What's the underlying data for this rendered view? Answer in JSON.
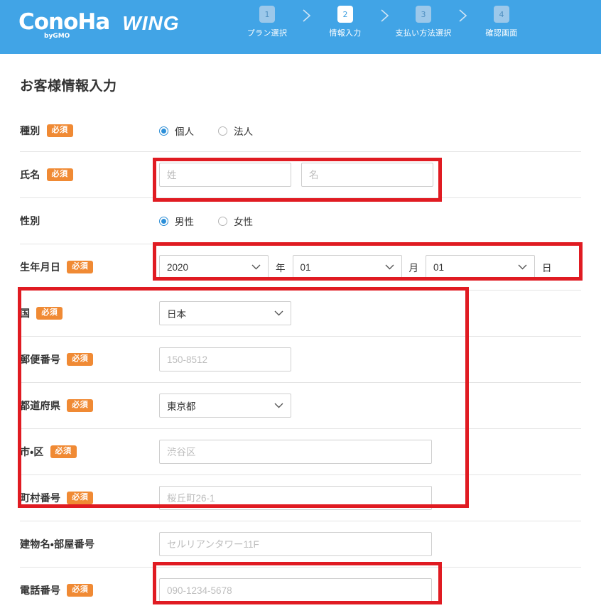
{
  "header": {
    "logo": {
      "brand": "ConoHa",
      "byline": "byGMO",
      "product": "WING"
    },
    "steps": [
      {
        "number": "1",
        "label": "プラン選択",
        "state": "done"
      },
      {
        "number": "2",
        "label": "情報入力",
        "state": "current"
      },
      {
        "number": "3",
        "label": "支払い方法選択",
        "state": "todo"
      },
      {
        "number": "4",
        "label": "確認画面",
        "state": "todo"
      }
    ],
    "separator_icon": "chevron-right-icon",
    "background_color": "#41a4e6"
  },
  "page": {
    "title": "お客様情報入力",
    "required_badge": "必須",
    "accent_color": "#f08a34",
    "highlight_color": "#e01b22"
  },
  "form": {
    "rows": {
      "type": {
        "label": "種別",
        "options": [
          {
            "label": "個人",
            "selected": true
          },
          {
            "label": "法人",
            "selected": false
          }
        ]
      },
      "name": {
        "label": "氏名",
        "last_name_placeholder": "姓",
        "last_name_value": "",
        "first_name_placeholder": "名",
        "first_name_value": ""
      },
      "gender": {
        "label": "性別",
        "options": [
          {
            "label": "男性",
            "selected": true
          },
          {
            "label": "女性",
            "selected": false
          }
        ]
      },
      "birthday": {
        "label": "生年月日",
        "year_value": "2020",
        "year_unit": "年",
        "month_value": "01",
        "month_unit": "月",
        "day_value": "01",
        "day_unit": "日"
      },
      "country": {
        "label": "国",
        "value": "日本"
      },
      "postal": {
        "label": "郵便番号",
        "placeholder": "150-8512",
        "value": ""
      },
      "prefecture": {
        "label": "都道府県",
        "value": "東京都"
      },
      "city": {
        "label": "市・区",
        "placeholder": "渋谷区",
        "value": ""
      },
      "town": {
        "label": "町村番号",
        "placeholder": "桜丘町26-1",
        "value": ""
      },
      "building": {
        "label": "建物名・部屋番号",
        "placeholder": "セルリアンタワー11F",
        "value": ""
      },
      "phone": {
        "label": "電話番号",
        "placeholder": "090-1234-5678",
        "value": ""
      }
    }
  }
}
